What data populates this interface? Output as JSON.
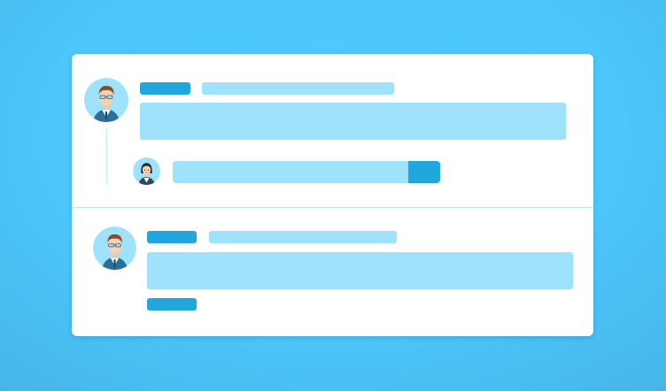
{
  "colors": {
    "background": "#4cc6fb",
    "card": "#ffffff",
    "accent": "#1fa7de",
    "placeholder": "#9fe2fc",
    "divider": "#bfe6f6"
  },
  "comments": [
    {
      "avatar_icon": "man-with-glasses-avatar-icon",
      "reply": {
        "avatar_icon": "woman-avatar-icon"
      }
    },
    {
      "avatar_icon": "man-with-glasses-avatar-icon"
    }
  ]
}
